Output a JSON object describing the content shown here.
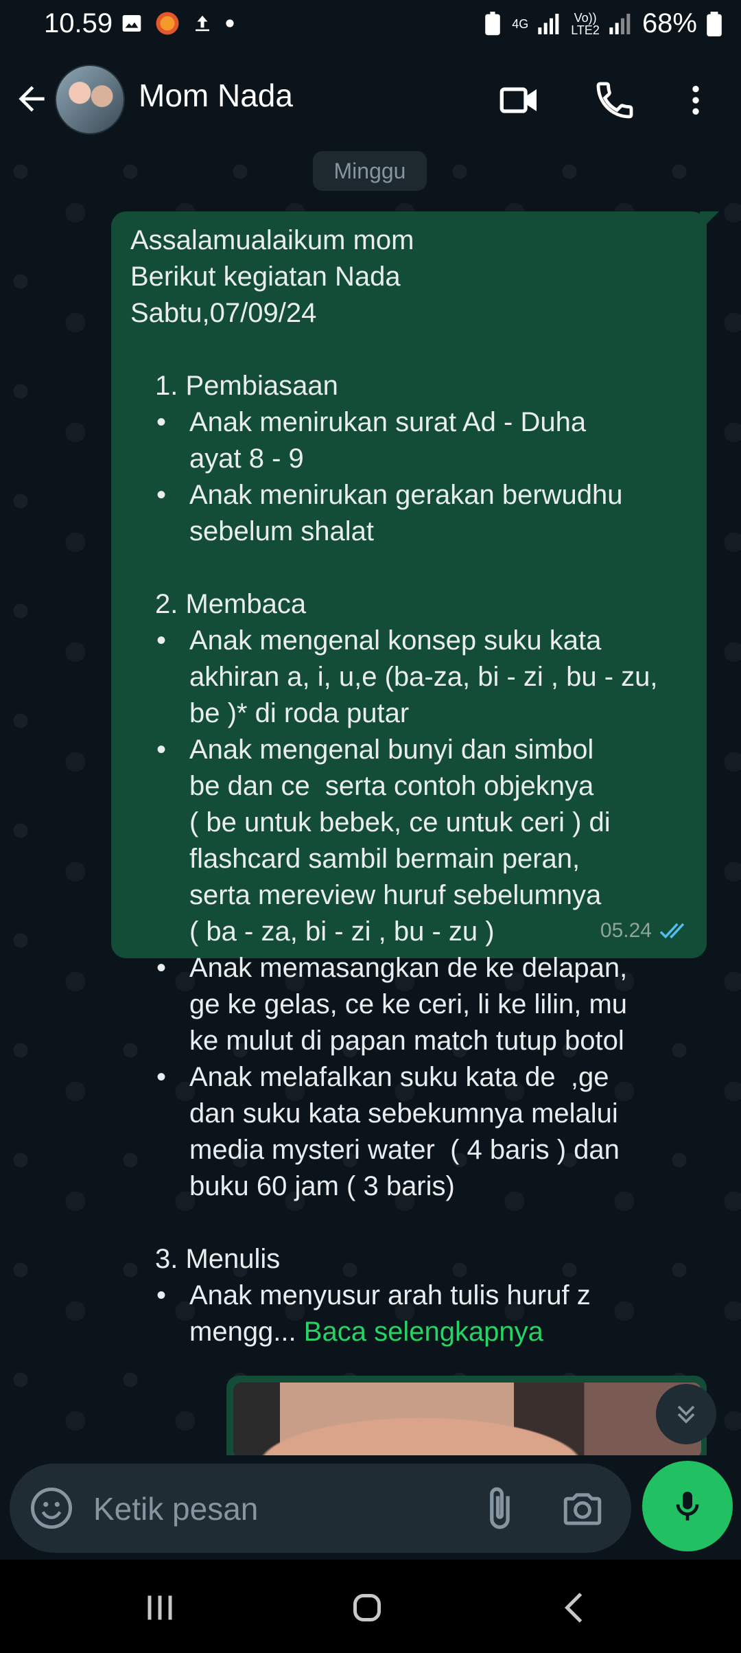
{
  "status_bar": {
    "time": "10.59",
    "network_4g": "4G",
    "lte_label_top": "Vo))",
    "lte_label_bottom": "LTE2",
    "battery": "68%"
  },
  "header": {
    "contact_name": "Mom Nada"
  },
  "chat": {
    "date_chip": "Minggu",
    "message": {
      "lines": [
        "Assalamualaikum mom",
        "Berikut kegiatan Nada",
        "Sabtu,07/09/24"
      ],
      "sections": [
        {
          "title": "1. Pembiasaan",
          "bullets": [
            [
              "Anak menirukan surat Ad - Duha",
              "ayat 8 - 9"
            ],
            [
              "Anak menirukan gerakan berwudhu",
              "sebelum shalat"
            ]
          ]
        },
        {
          "title": "2. Membaca",
          "bullets": [
            [
              "Anak mengenal konsep suku kata",
              "akhiran a, i, u,e (ba-za, bi - zi , bu - zu,",
              "be )* di roda putar"
            ],
            [
              "Anak mengenal bunyi dan simbol",
              "be dan ce  serta contoh objeknya",
              "( be untuk bebek, ce untuk ceri ) di",
              "flashcard sambil bermain peran,",
              "serta mereview huruf sebelumnya",
              "( ba - za, bi - zi , bu - zu )"
            ],
            [
              "Anak memasangkan de ke delapan,",
              "ge ke gelas, ce ke ceri, li ke lilin, mu",
              "ke mulut di papan match tutup botol"
            ],
            [
              "Anak melafalkan suku kata de  ,ge",
              "dan suku kata sebekumnya melalui",
              "media mysteri water  ( 4 baris ) dan",
              "buku 60 jam ( 3 baris)"
            ]
          ]
        },
        {
          "title": "3. Menulis",
          "bullets": [
            [
              "Anak menyusur arah tulis huruf z"
            ]
          ]
        }
      ],
      "truncated_text": "mengg...",
      "read_more": "Baca selengkapnya",
      "time": "05.24",
      "status": "read"
    }
  },
  "input": {
    "placeholder": "Ketik pesan"
  },
  "colors": {
    "background": "#0b141a",
    "bubble_outgoing": "#134d37",
    "accent_green": "#25d366",
    "mic_green": "#21c063",
    "read_tick": "#53bdeb"
  }
}
